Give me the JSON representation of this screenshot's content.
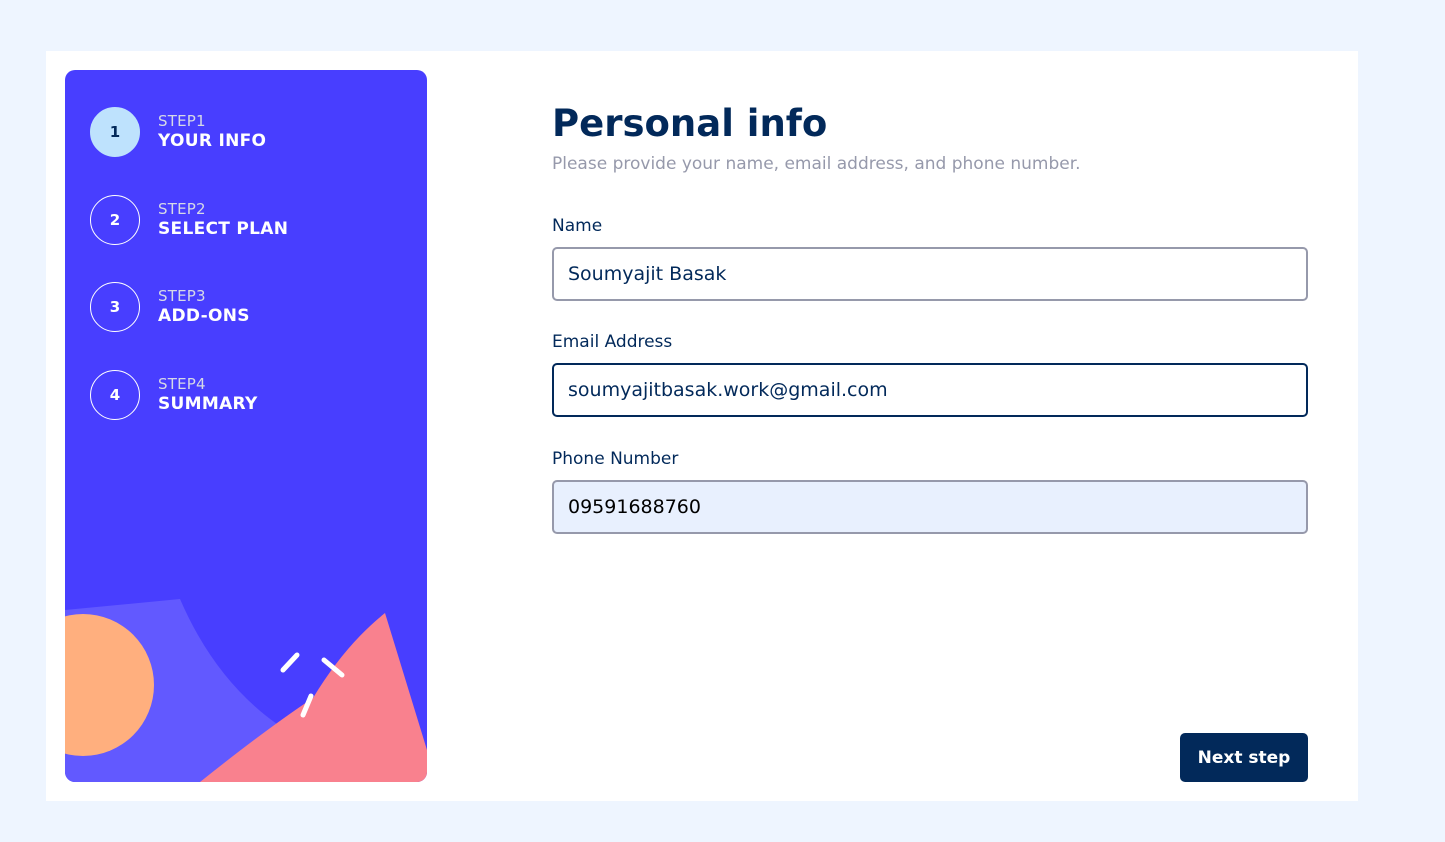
{
  "steps": [
    {
      "number": "1",
      "label": "STEP1",
      "title": "YOUR INFO",
      "active": true
    },
    {
      "number": "2",
      "label": "STEP2",
      "title": "SELECT PLAN",
      "active": false
    },
    {
      "number": "3",
      "label": "STEP3",
      "title": "ADD-ONS",
      "active": false
    },
    {
      "number": "4",
      "label": "STEP4",
      "title": "SUMMARY",
      "active": false
    }
  ],
  "form": {
    "title": "Personal info",
    "subtitle": "Please provide your name, email address, and phone number.",
    "name": {
      "label": "Name",
      "value": "Soumyajit Basak"
    },
    "email": {
      "label": "Email Address",
      "value": "soumyajitbasak.work@gmail.com"
    },
    "phone": {
      "label": "Phone Number",
      "value": "09591688760"
    }
  },
  "next_button_label": "Next step",
  "colors": {
    "sidebar": "#483eff",
    "active_step": "#bee2fd",
    "marine_blue": "#02295a",
    "grey_text": "#9699ab",
    "page_bg": "#eef5ff"
  }
}
